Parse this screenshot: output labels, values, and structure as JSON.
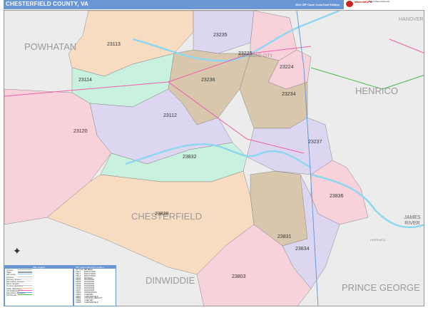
{
  "header": {
    "title": "CHESTERFIELD COUNTY, VA",
    "subtitle": "2020 ZIP Code ColorCast Edition",
    "logo_text": "MarketMAPS",
    "logo_side_text": "Sales Maps Delivered"
  },
  "colors": {
    "header": "#6a96d6",
    "peach": "#f8dcc2",
    "pink": "#f8d2da",
    "lavender": "#ddd6f1",
    "mint": "#c9f1df",
    "tan": "#d8c6ad",
    "background": "#ececec",
    "water": "#8fd6f0"
  },
  "counties": [
    "POWHATAN",
    "HENRICO",
    "HANOVER",
    "DINWIDDIE",
    "PRINCE GEORGE",
    "CHESTERFIELD"
  ],
  "places": [
    "RICHMOND CITY",
    "HOPEWELL",
    "JAMES RIVER"
  ],
  "zips": [
    {
      "zip": "23113",
      "color": "peach"
    },
    {
      "zip": "23235",
      "color": "lavender"
    },
    {
      "zip": "23225",
      "color": "pink"
    },
    {
      "zip": "23114",
      "color": "mint"
    },
    {
      "zip": "23236",
      "color": "tan"
    },
    {
      "zip": "23224",
      "color": "pink"
    },
    {
      "zip": "23234",
      "color": "tan"
    },
    {
      "zip": "23112",
      "color": "lavender"
    },
    {
      "zip": "23120",
      "color": "pink"
    },
    {
      "zip": "23237",
      "color": "lavender"
    },
    {
      "zip": "23832",
      "color": "mint"
    },
    {
      "zip": "23836",
      "color": "pink"
    },
    {
      "zip": "23838",
      "color": "peach"
    },
    {
      "zip": "23831",
      "color": "tan"
    },
    {
      "zip": "23834",
      "color": "lavender"
    },
    {
      "zip": "23803",
      "color": "pink"
    }
  ],
  "legend": {
    "title": "Map Legend",
    "items": [
      "County",
      "State",
      "ZIP Code",
      "Primary",
      "Primary Streets",
      "Secondary Streets",
      "Minor Streets",
      "County Highways",
      "State Highways",
      "US Highways",
      "Interstate Highways",
      "Toll Roads"
    ]
  },
  "zip_index": {
    "title": "ZIP Code Index/Grid Location",
    "columns": [
      "ZIP Code",
      "ZIP Name"
    ],
    "rows": [
      [
        "23112",
        "MIDLOTHIAN"
      ],
      [
        "23113",
        "MIDLOTHIAN"
      ],
      [
        "23114",
        "MIDLOTHIAN"
      ],
      [
        "23120",
        "MOSELEY"
      ],
      [
        "23224",
        "RICHMOND"
      ],
      [
        "23225",
        "RICHMOND"
      ],
      [
        "23234",
        "RICHMOND"
      ],
      [
        "23235",
        "RICHMOND"
      ],
      [
        "23236",
        "RICHMOND"
      ],
      [
        "23237",
        "RICHMOND"
      ],
      [
        "23803",
        "PETERSBURG"
      ],
      [
        "23831",
        "CHESTER"
      ],
      [
        "23832",
        "CHESTERFIELD"
      ],
      [
        "23834",
        "COLONIAL HEIGHTS"
      ],
      [
        "23836",
        "CHESTER"
      ],
      [
        "23838",
        "CHESTERFIELD"
      ]
    ]
  }
}
